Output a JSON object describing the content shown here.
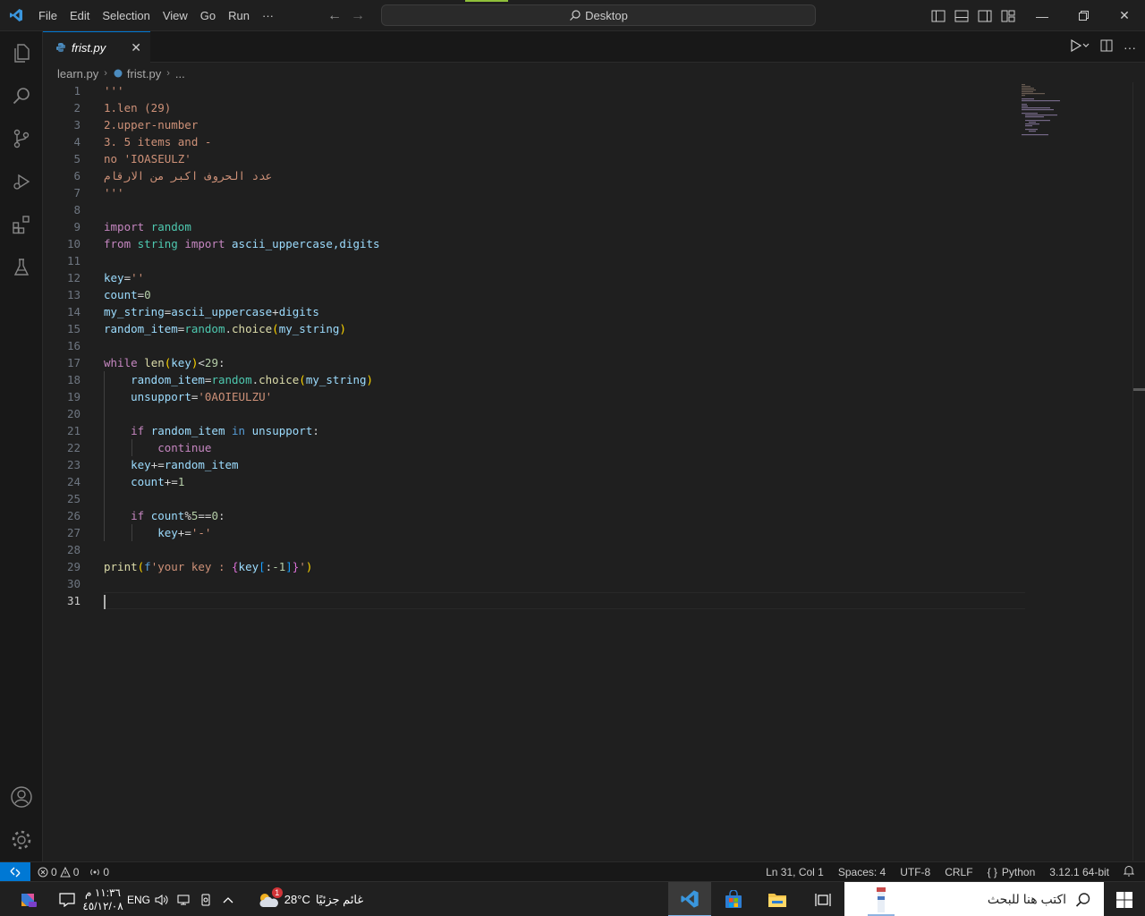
{
  "titlebar": {
    "menu": [
      "File",
      "Edit",
      "Selection",
      "View",
      "Go",
      "Run",
      "···"
    ],
    "search": "Desktop"
  },
  "tab": {
    "label": "frist.py",
    "close": "✕"
  },
  "breadcrumb": {
    "folder": "learn.py",
    "file": "frist.py",
    "more": "..."
  },
  "editor": {
    "line_numbers": [
      "1",
      "2",
      "3",
      "4",
      "5",
      "6",
      "7",
      "8",
      "9",
      "10",
      "11",
      "12",
      "13",
      "14",
      "15",
      "16",
      "17",
      "18",
      "19",
      "20",
      "21",
      "22",
      "23",
      "24",
      "25",
      "26",
      "27",
      "28",
      "29",
      "30",
      "31"
    ],
    "current_line": 31
  },
  "code": {
    "l1": "'''",
    "l2": "1.len (29)",
    "l3": "2.upper-number",
    "l4": "3. 5 items and -",
    "l5": "no 'IOASEULZ'",
    "l6": "عدد الحروف اكبر من الارقام",
    "l7": "'''",
    "l9_kw": "import",
    "l9_mod": "random",
    "l10_from": "from",
    "l10_mod": "string",
    "l10_import": "import",
    "l10_names": "ascii_uppercase,digits",
    "l12_var": "key",
    "l12_op": "=",
    "l12_str": "''",
    "l13_var": "count",
    "l13_op": "=",
    "l13_num": "0",
    "l14_var": "my_string",
    "l14_op": "=",
    "l14_a": "ascii_uppercase",
    "l14_plus": "+",
    "l14_b": "digits",
    "l15_var": "random_item",
    "l15_op": "=",
    "l15_mod": "random",
    "l15_dot": ".",
    "l15_fn": "choice",
    "l15_open": "(",
    "l15_arg": "my_string",
    "l15_close": ")",
    "l17_kw": "while",
    "l17_fn": "len",
    "l17_open": "(",
    "l17_arg": "key",
    "l17_close": ")",
    "l17_op": "<",
    "l17_num": "29",
    "l17_colon": ":",
    "l18_var": "random_item",
    "l18_op": "=",
    "l18_mod": "random",
    "l18_dot": ".",
    "l18_fn": "choice",
    "l18_open": "(",
    "l18_arg": "my_string",
    "l18_close": ")",
    "l19_var": "unsupport",
    "l19_op": "=",
    "l19_str": "'0AOIEULZU'",
    "l21_kw": "if",
    "l21_var": "random_item",
    "l21_in": "in",
    "l21_b": "unsupport",
    "l21_colon": ":",
    "l22_kw": "continue",
    "l23_var": "key",
    "l23_op": "+=",
    "l23_b": "random_item",
    "l24_var": "count",
    "l24_op": "+=",
    "l24_num": "1",
    "l26_kw": "if",
    "l26_var": "count",
    "l26_op": "%",
    "l26_num": "5",
    "l26_eq": "==",
    "l26_num2": "0",
    "l26_colon": ":",
    "l27_var": "key",
    "l27_op": "+=",
    "l27_str": "'-'",
    "l29_fn": "print",
    "l29_open": "(",
    "l29_f": "f",
    "l29_s1": "'your key : ",
    "l29_b1": "{",
    "l29_var": "key",
    "l29_b2": "[",
    "l29_op": ":",
    "l29_num": "-1",
    "l29_b3": "]",
    "l29_b4": "}",
    "l29_s2": "'",
    "l29_close": ")"
  },
  "statusbar": {
    "errors": "0",
    "warnings": "0",
    "ports": "0",
    "position": "Ln 31, Col 1",
    "spaces": "Spaces: 4",
    "encoding": "UTF-8",
    "eol": "CRLF",
    "language": "Python",
    "interpreter": "3.12.1 64-bit"
  },
  "taskbar": {
    "time": "١١:٣٦ م",
    "date": "٤٥/١٢/٠٨",
    "lang": "ENG",
    "temperature": "28°C",
    "weather": "غائم جزئيًا",
    "weather_badge": "1",
    "search_placeholder": "اكتب هنا للبحث"
  },
  "colors": {
    "accent": "#0078d4",
    "editor_bg": "#1f1f1f",
    "sidebar_bg": "#181818"
  }
}
